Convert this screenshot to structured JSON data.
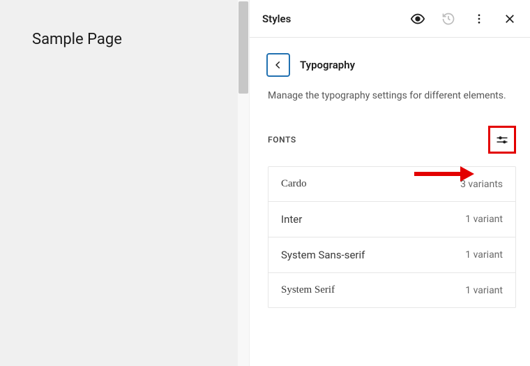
{
  "canvas": {
    "page_title": "Sample Page"
  },
  "sidebar": {
    "title": "Styles",
    "section": {
      "title": "Typography",
      "description": "Manage the typography settings for different elements."
    },
    "fonts": {
      "label": "FONTS",
      "items": [
        {
          "name": "Cardo",
          "variants": "3 variants",
          "serif": true
        },
        {
          "name": "Inter",
          "variants": "1 variant",
          "serif": false
        },
        {
          "name": "System Sans-serif",
          "variants": "1 variant",
          "serif": false
        },
        {
          "name": "System Serif",
          "variants": "1 variant",
          "serif": true
        }
      ]
    }
  }
}
